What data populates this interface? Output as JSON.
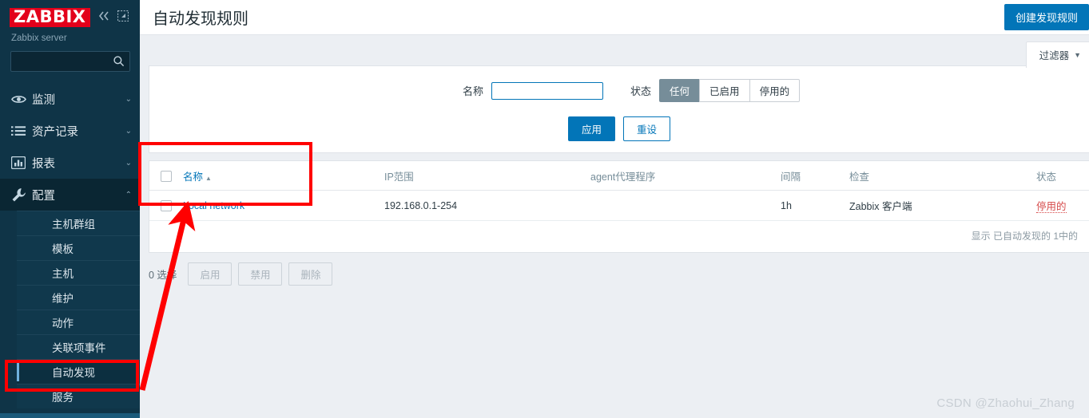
{
  "sidebar": {
    "logo": "ZABBIX",
    "collapse_icon": "double-chevron-left-icon",
    "compact_icon": "compact-view-icon",
    "server_name": "Zabbix server",
    "search": {
      "value": "",
      "placeholder": ""
    },
    "nav": [
      {
        "label": "监测",
        "icon": "eye-icon",
        "chevron": "⌄",
        "active": false
      },
      {
        "label": "资产记录",
        "icon": "list-icon",
        "chevron": "⌄",
        "active": false
      },
      {
        "label": "报表",
        "icon": "bar-chart-icon",
        "chevron": "⌄",
        "active": false
      },
      {
        "label": "配置",
        "icon": "wrench-icon",
        "chevron": "⌃",
        "active": true
      }
    ],
    "submenu": [
      {
        "label": "主机群组"
      },
      {
        "label": "模板"
      },
      {
        "label": "主机"
      },
      {
        "label": "维护"
      },
      {
        "label": "动作"
      },
      {
        "label": "关联项事件"
      },
      {
        "label": "自动发现"
      },
      {
        "label": "服务"
      }
    ]
  },
  "header": {
    "title": "自动发现规则",
    "create_button": "创建发现规则"
  },
  "filter": {
    "tab_label": "过滤器",
    "name_label": "名称",
    "name_value": "",
    "status_label": "状态",
    "status_options": [
      "任何",
      "已启用",
      "停用的"
    ],
    "status_selected": "任何",
    "apply_label": "应用",
    "reset_label": "重设"
  },
  "table": {
    "columns": [
      "名称",
      "IP范围",
      "agent代理程序",
      "间隔",
      "检查",
      "状态"
    ],
    "sort_column": "名称",
    "sort_arrow": "▲",
    "rows": [
      {
        "name": "Local network",
        "ip_range": "192.168.0.1-254",
        "proxy": "",
        "interval": "1h",
        "checks": "Zabbix 客户端",
        "status": "停用的"
      }
    ],
    "footer": "显示 已自动发现的 1中的"
  },
  "actions": {
    "selected_count": "0 选择",
    "buttons": [
      "启用",
      "禁用",
      "删除"
    ]
  },
  "watermark": "CSDN @Zhaohui_Zhang",
  "colors": {
    "sidebar_bg": "#0f3447",
    "logo_red": "#e3001b",
    "accent_blue": "#0275b8",
    "status_red": "#d64949",
    "annotation_red": "#ff0000",
    "segment_selected": "#768d99"
  }
}
